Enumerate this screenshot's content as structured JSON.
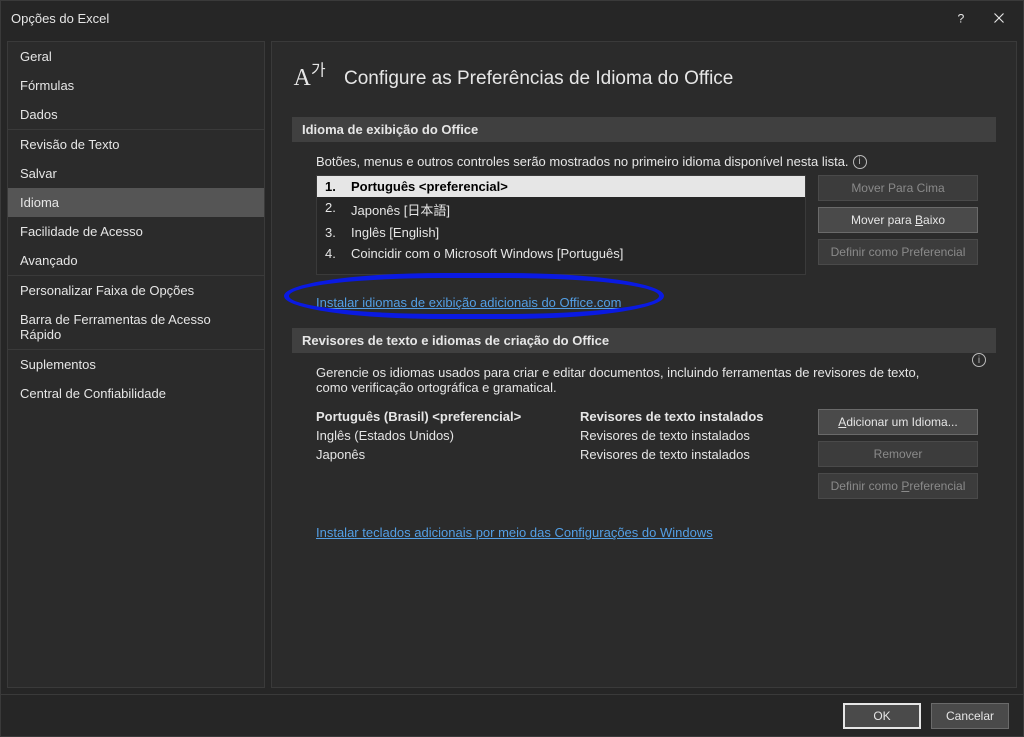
{
  "window_title": "Opções do Excel",
  "sidebar": {
    "items": [
      {
        "label": "Geral"
      },
      {
        "label": "Fórmulas"
      },
      {
        "label": "Dados"
      },
      {
        "label": "Revisão de Texto"
      },
      {
        "label": "Salvar"
      },
      {
        "label": "Idioma",
        "selected": true
      },
      {
        "label": "Facilidade de Acesso"
      },
      {
        "label": "Avançado"
      },
      {
        "label": "Personalizar Faixa de Opções"
      },
      {
        "label": "Barra de Ferramentas de Acesso Rápido"
      },
      {
        "label": "Suplementos"
      },
      {
        "label": "Central de Confiabilidade"
      }
    ]
  },
  "header": {
    "title": "Configure as Preferências de Idioma do Office"
  },
  "section1": {
    "title": "Idioma de exibição do Office",
    "desc": "Botões, menus e outros controles serão mostrados no primeiro idioma disponível nesta lista.",
    "langs": [
      {
        "num": "1.",
        "label": "Português <preferencial>",
        "selected": true
      },
      {
        "num": "2.",
        "label": "Japonês [日本語]"
      },
      {
        "num": "3.",
        "label": "Inglês [English]"
      },
      {
        "num": "4.",
        "label": "Coincidir com o Microsoft Windows [Português]"
      }
    ],
    "buttons": {
      "move_up": "Mover Para Cima",
      "move_down": "Mover para Baixo",
      "set_pref": "Definir como Preferencial"
    },
    "link": "Instalar idiomas de exibição adicionais do Office.com"
  },
  "section2": {
    "title": "Revisores de texto e idiomas de criação do Office",
    "desc": "Gerencie os idiomas usados para criar e editar documentos, incluindo ferramentas de revisores de texto, como verificação ortográfica e gramatical.",
    "rows": [
      {
        "lang": "Português (Brasil) <preferencial>",
        "status": "Revisores de texto instalados",
        "pref": true
      },
      {
        "lang": "Inglês (Estados Unidos)",
        "status": "Revisores de texto instalados"
      },
      {
        "lang": "Japonês",
        "status": "Revisores de texto instalados"
      }
    ],
    "buttons": {
      "add": "Adicionar um Idioma...",
      "remove": "Remover",
      "set_pref": "Definir como Preferencial"
    },
    "link": "Instalar teclados adicionais por meio das Configurações do Windows"
  },
  "footer": {
    "ok": "OK",
    "cancel": "Cancelar"
  }
}
